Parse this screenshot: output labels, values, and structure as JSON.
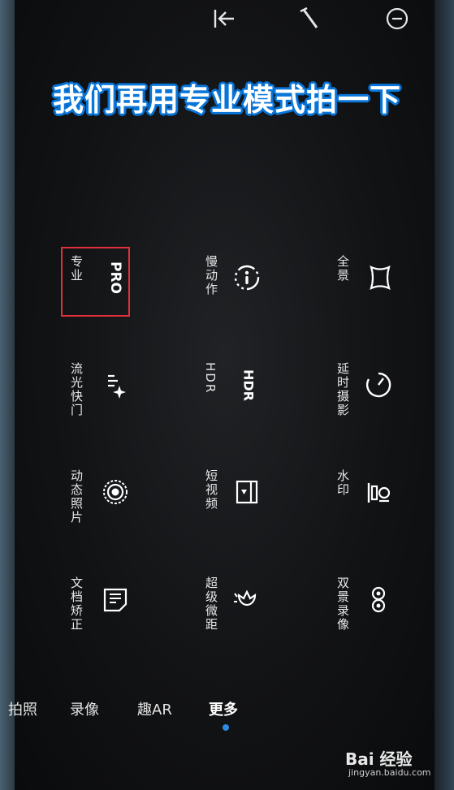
{
  "caption": "我们再用专业模式拍一下",
  "toolbar": {
    "icons": [
      "back-to-start-icon",
      "pen-icon",
      "minus-circle-icon"
    ]
  },
  "modes": [
    {
      "label": "专业",
      "badge": "PRO",
      "icon": "pro-text-icon",
      "selected": true
    },
    {
      "label": "慢动作",
      "icon": "slow-motion-icon"
    },
    {
      "label": "全景",
      "icon": "panorama-icon"
    },
    {
      "label": "流光快门",
      "icon": "light-painting-icon"
    },
    {
      "label": "HDR",
      "badge": "HDR",
      "icon": "hdr-text-icon"
    },
    {
      "label": "延时摄影",
      "icon": "timelapse-icon"
    },
    {
      "label": "动态照片",
      "icon": "moving-picture-icon"
    },
    {
      "label": "短视频",
      "icon": "short-video-icon"
    },
    {
      "label": "水印",
      "icon": "watermark-stamp-icon"
    },
    {
      "label": "文档矫正",
      "icon": "document-correction-icon"
    },
    {
      "label": "超级微距",
      "icon": "super-macro-icon"
    },
    {
      "label": "双景录像",
      "icon": "dual-view-icon"
    }
  ],
  "tabs": {
    "photo_partial": "拍照",
    "video": "录像",
    "ar": "趣AR",
    "more": "更多",
    "active": "更多"
  },
  "watermark": {
    "brand": "Bai 经验",
    "url": "jingyan.baidu.com"
  },
  "colors": {
    "highlight": "#e0303a",
    "caption_stroke": "#0a76d9",
    "tab_indicator": "#2b8be6"
  }
}
